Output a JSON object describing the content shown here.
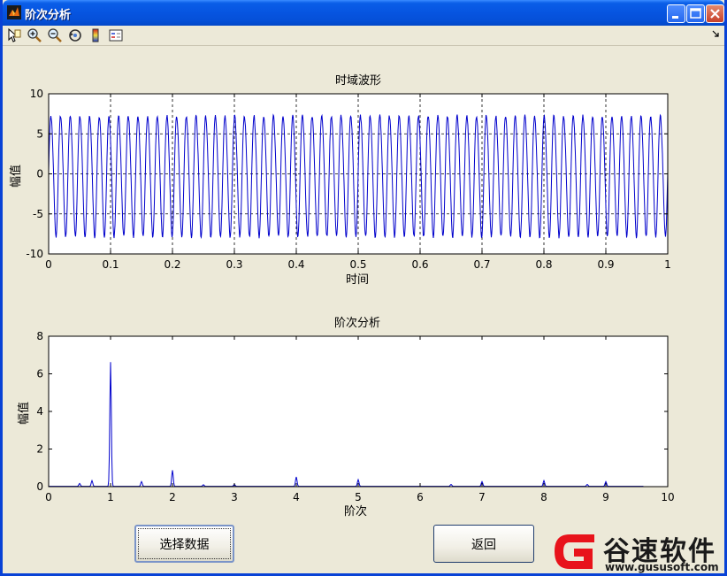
{
  "window": {
    "title": "阶次分析"
  },
  "toolbar": {
    "tools": [
      "edit-plot-icon",
      "zoom-in-icon",
      "zoom-out-icon",
      "rotate-icon",
      "colorbar-icon",
      "legend-icon"
    ]
  },
  "plots": [
    {
      "title": "时域波形",
      "xlabel": "时间",
      "ylabel": "幅值",
      "xlim": [
        0,
        1
      ],
      "ylim": [
        -10,
        10
      ],
      "xticks": [
        "0",
        "0.1",
        "0.2",
        "0.3",
        "0.4",
        "0.5",
        "0.6",
        "0.7",
        "0.8",
        "0.9",
        "1"
      ],
      "yticks": [
        "10",
        "5",
        "0",
        "-5",
        "-10"
      ],
      "grid": true
    },
    {
      "title": "阶次分析",
      "xlabel": "阶次",
      "ylabel": "幅值",
      "xlim": [
        0,
        10
      ],
      "ylim": [
        0,
        8
      ],
      "xticks": [
        "0",
        "1",
        "2",
        "3",
        "4",
        "5",
        "6",
        "7",
        "8",
        "9",
        "10"
      ],
      "yticks": [
        "8",
        "6",
        "4",
        "2",
        "0"
      ],
      "grid": false
    }
  ],
  "chart_data": [
    {
      "type": "line",
      "title": "时域波形",
      "xlabel": "时间",
      "ylabel": "幅值",
      "xlim": [
        0,
        1
      ],
      "ylim": [
        -10,
        10
      ],
      "grid": true,
      "series": [
        {
          "color": "#0000cc",
          "approx_cycles": 64,
          "amplitude": 7.5
        }
      ]
    },
    {
      "type": "line",
      "title": "阶次分析",
      "xlabel": "阶次",
      "ylabel": "幅值",
      "xlim": [
        0,
        10
      ],
      "ylim": [
        0,
        8
      ],
      "grid": false,
      "series": [
        {
          "color": "#0000cc",
          "peaks": [
            {
              "x": 0.5,
              "y": 0.15
            },
            {
              "x": 0.7,
              "y": 0.3
            },
            {
              "x": 1.0,
              "y": 6.6
            },
            {
              "x": 1.5,
              "y": 0.25
            },
            {
              "x": 2.0,
              "y": 0.85
            },
            {
              "x": 2.5,
              "y": 0.08
            },
            {
              "x": 3.0,
              "y": 0.1
            },
            {
              "x": 4.0,
              "y": 0.5
            },
            {
              "x": 5.0,
              "y": 0.35
            },
            {
              "x": 6.5,
              "y": 0.1
            },
            {
              "x": 7.0,
              "y": 0.25
            },
            {
              "x": 8.0,
              "y": 0.3
            },
            {
              "x": 8.7,
              "y": 0.1
            },
            {
              "x": 9.0,
              "y": 0.25
            }
          ]
        }
      ]
    }
  ],
  "buttons": {
    "select_data": "选择数据",
    "back": "返回"
  },
  "watermark": {
    "name": "谷速软件",
    "url": "www.gususoft.com"
  },
  "colors": {
    "titlebar": "#0654e0",
    "plot_line": "#0000cc",
    "background": "#ece9d8",
    "watermark_red": "#e8131b"
  }
}
